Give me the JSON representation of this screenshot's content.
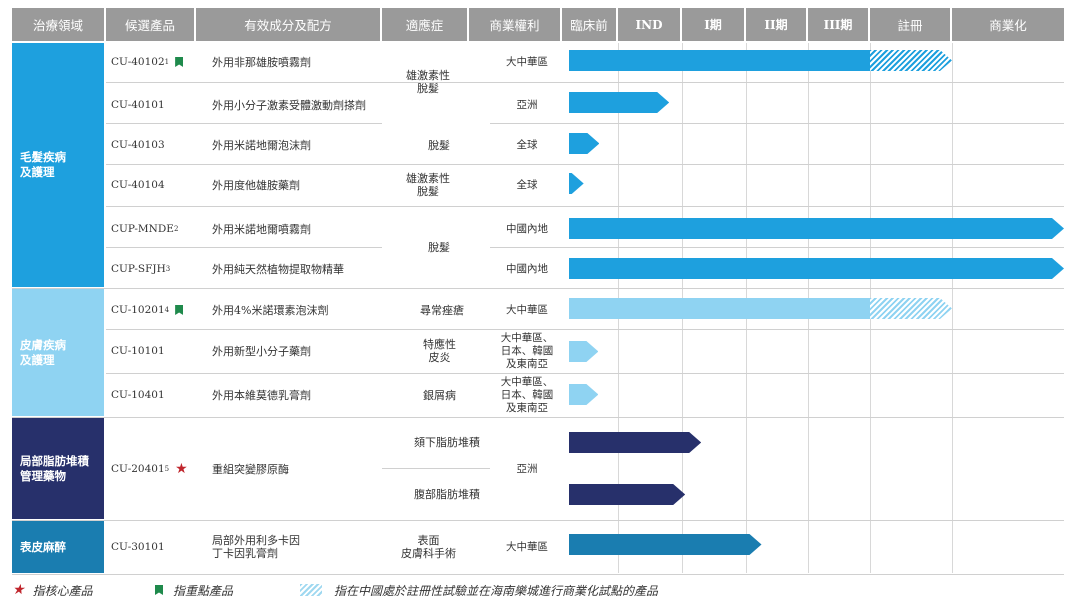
{
  "headers": [
    "治療領域",
    "候選產品",
    "有效成分及配方",
    "適應症",
    "商業權利",
    "臨床前",
    "IND",
    "I期",
    "II期",
    "III期",
    "註冊",
    "商業化"
  ],
  "areas": [
    {
      "label": "毛髮疾病\n及護理",
      "color": "#1ea0de"
    },
    {
      "label": "皮膚疾病\n及護理",
      "color": "#8fd3f2"
    },
    {
      "label": "局部脂肪堆積\n管理藥物",
      "color": "#27306b"
    },
    {
      "label": "表皮麻醉",
      "color": "#1a7db0"
    }
  ],
  "products": [
    {
      "code": "CU-40102",
      "sup": "1",
      "ingredient": "外用非那雄胺噴霧劑",
      "rights": "大中華區",
      "mark": "flag"
    },
    {
      "code": "CU-40101",
      "sup": "",
      "ingredient": "外用小分子激素受體激動劑搽劑",
      "rights": "亞洲",
      "mark": ""
    },
    {
      "code": "CU-40103",
      "sup": "",
      "ingredient": "外用米諾地爾泡沫劑",
      "rights": "全球",
      "mark": ""
    },
    {
      "code": "CU-40104",
      "sup": "",
      "ingredient": "外用度他雄胺藥劑",
      "rights": "全球",
      "mark": ""
    },
    {
      "code": "CUP-MNDE",
      "sup": "2",
      "ingredient": "外用米諾地爾噴霧劑",
      "rights": "中國內地",
      "mark": ""
    },
    {
      "code": "CUP-SFJH",
      "sup": "3",
      "ingredient": "外用純天然植物提取物精華",
      "rights": "中國內地",
      "mark": ""
    },
    {
      "code": "CU-10201",
      "sup": "4",
      "ingredient": "外用4%米諾環素泡沫劑",
      "rights": "大中華區",
      "mark": "flag"
    },
    {
      "code": "CU-10101",
      "sup": "",
      "ingredient": "外用新型小分子藥劑",
      "rights": "大中華區、\n日本、韓國\n及東南亞",
      "mark": ""
    },
    {
      "code": "CU-10401",
      "sup": "",
      "ingredient": "外用本維莫德乳膏劑",
      "rights": "大中華區、\n日本、韓國\n及東南亞",
      "mark": ""
    },
    {
      "code": "CU-20401",
      "sup": "5",
      "ingredient": "重組突變膠原酶",
      "rights": "亞洲",
      "mark": "star"
    },
    {
      "code": "CU-30101",
      "sup": "",
      "ingredient": "局部外用利多卡因\n丁卡因乳膏劑",
      "rights": "大中華區",
      "mark": ""
    }
  ],
  "indications": [
    {
      "label": "雄激素性\n脫髮"
    },
    {
      "label": "脫髮"
    },
    {
      "label": "雄激素性\n脫髮"
    },
    {
      "label": "脫髮"
    },
    {
      "label": "尋常痤瘡"
    },
    {
      "label": "特應性\n皮炎"
    },
    {
      "label": "銀屑病"
    },
    {
      "label": "頦下脂肪堆積"
    },
    {
      "label": "腹部脂肪堆積"
    },
    {
      "label": "表面\n皮膚科手術"
    }
  ],
  "bars": [
    {
      "row": "CU-40102",
      "area": 0,
      "end": 6,
      "hatch": [
        5,
        6
      ]
    },
    {
      "row": "CU-40101",
      "area": 0,
      "end": 1.8
    },
    {
      "row": "CU-40103",
      "area": 0,
      "end": 0.62
    },
    {
      "row": "CU-40104",
      "area": 0,
      "end": 0.3
    },
    {
      "row": "CUP-MNDE",
      "area": 0,
      "end": 7
    },
    {
      "row": "CUP-SFJH",
      "area": 0,
      "end": 7
    },
    {
      "row": "CU-10201",
      "area": 1,
      "end": 6,
      "hatch": [
        5,
        6
      ]
    },
    {
      "row": "CU-10101",
      "area": 1,
      "end": 0.6
    },
    {
      "row": "CU-10401",
      "area": 1,
      "end": 0.6
    },
    {
      "row": "CU-20401-a",
      "area": 2,
      "end": 2.3
    },
    {
      "row": "CU-20401-b",
      "area": 2,
      "end": 2.05
    },
    {
      "row": "CU-30101",
      "area": 3,
      "end": 3.25
    }
  ],
  "legend": {
    "star_label": "指核心產品",
    "flag_label": "指重點產品",
    "hatch_label": "指在中國處於註冊性試驗並在海南樂城進行商業化試點的產品"
  }
}
